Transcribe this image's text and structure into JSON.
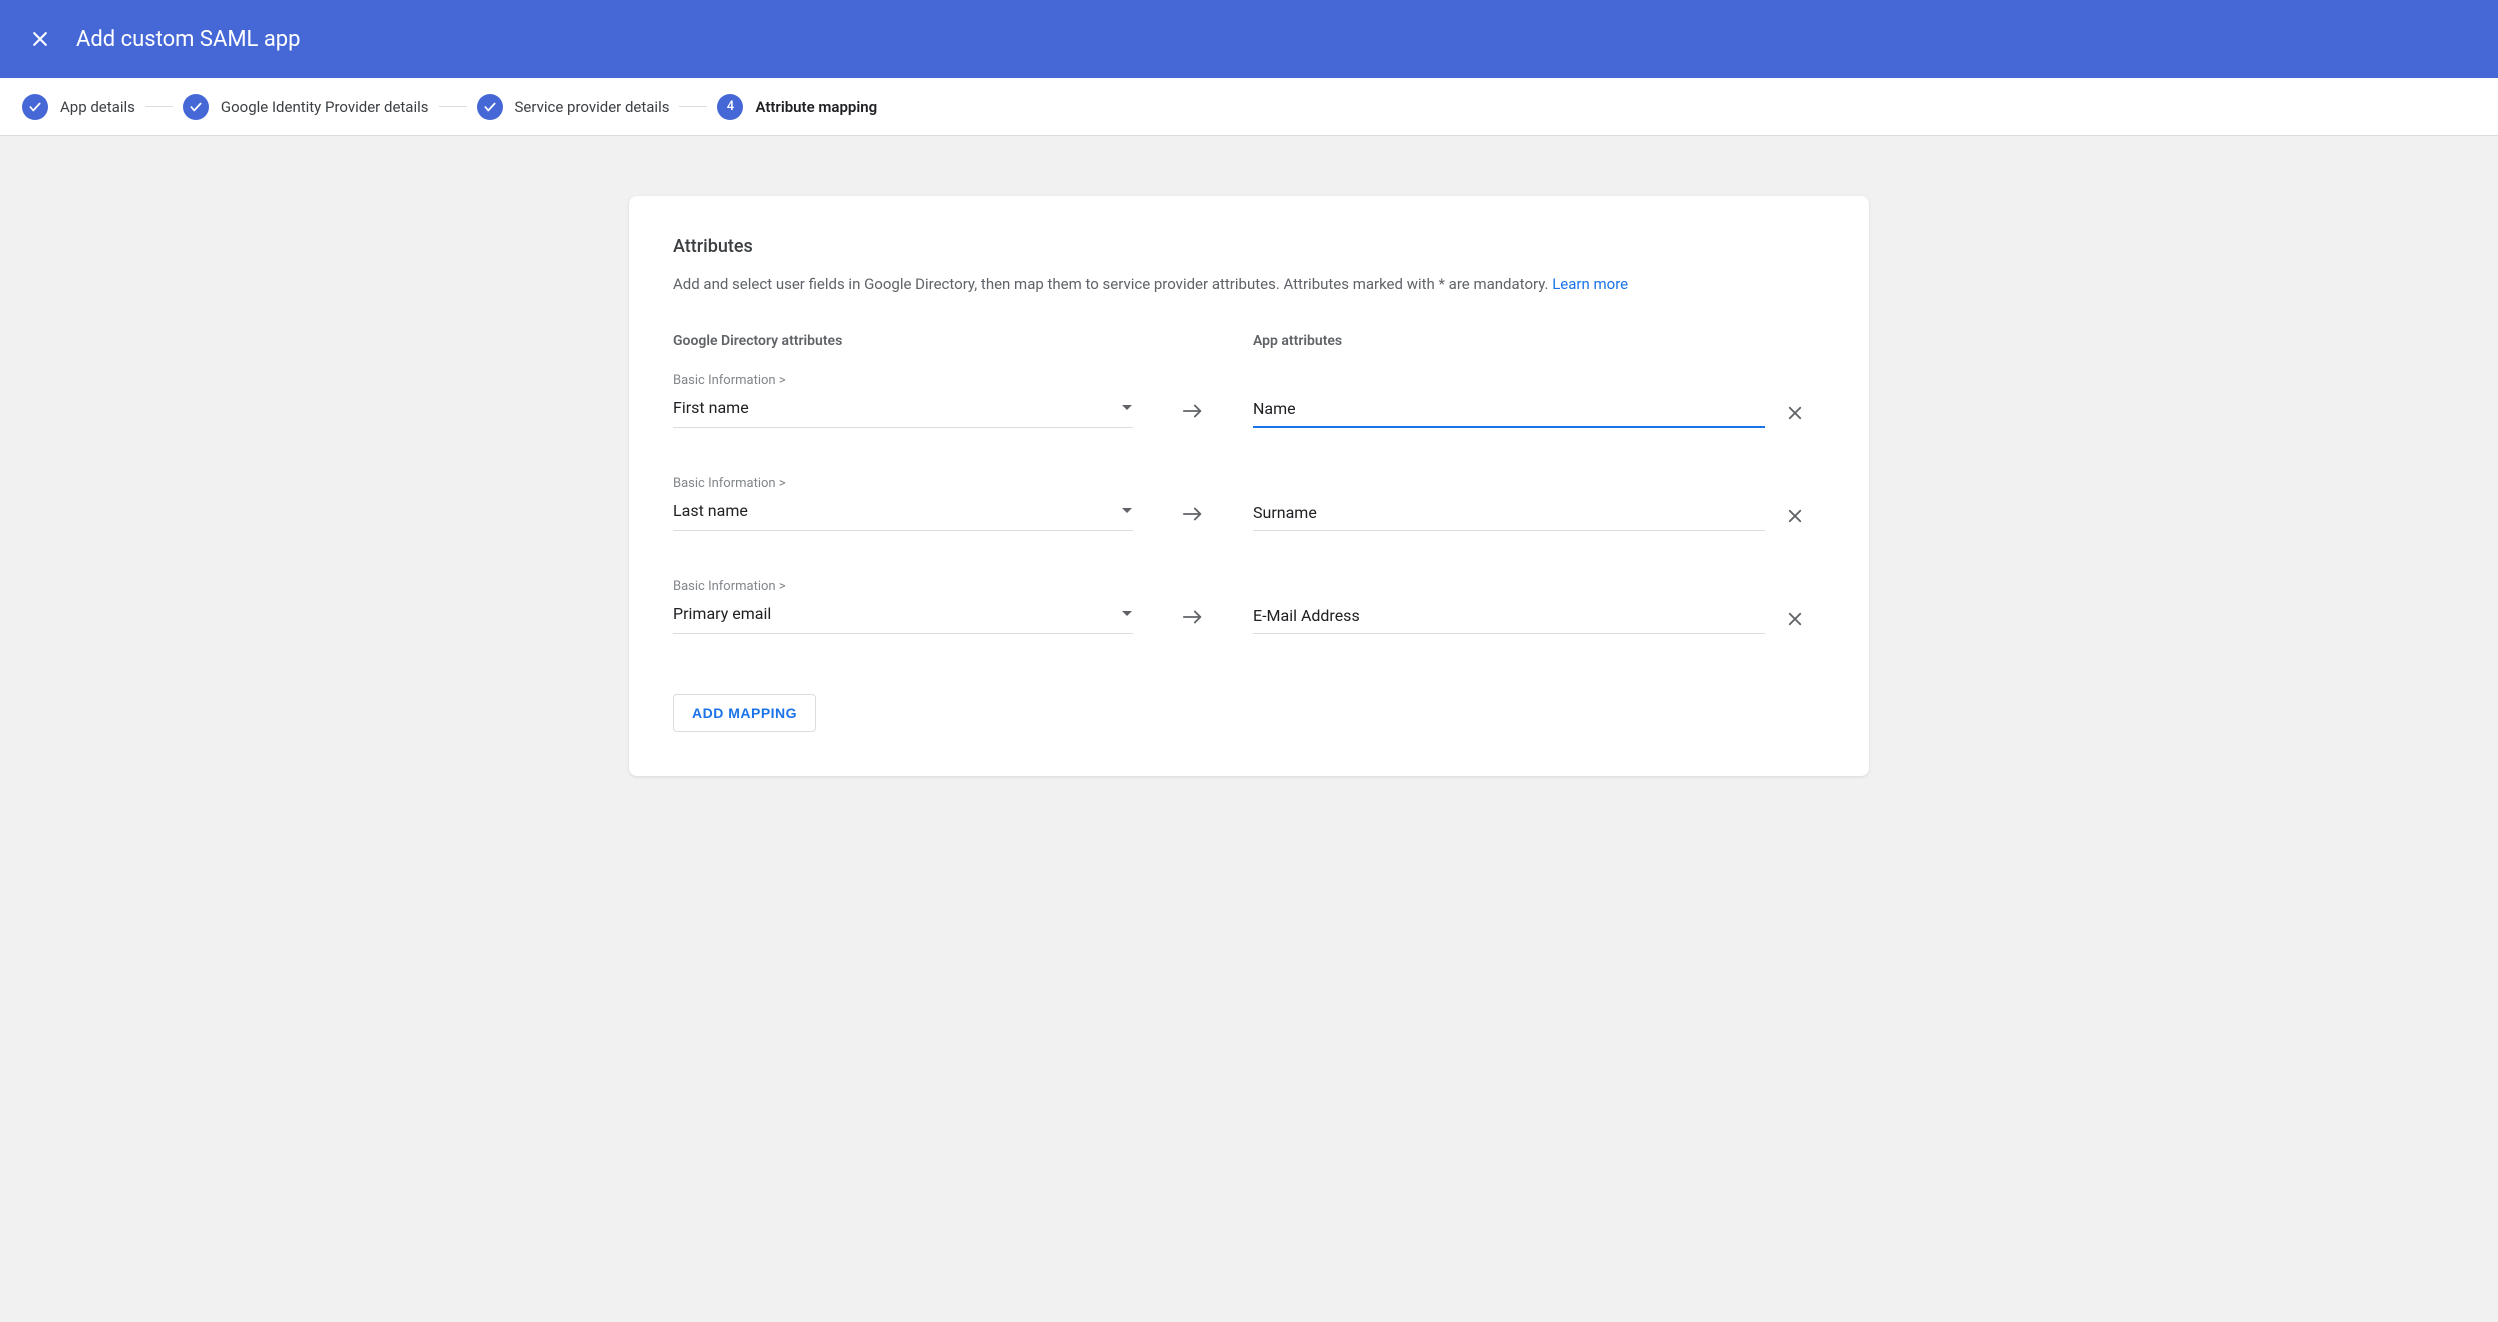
{
  "header": {
    "title": "Add custom SAML app"
  },
  "stepper": {
    "steps": [
      {
        "label": "App details",
        "state": "done"
      },
      {
        "label": "Google Identity Provider details",
        "state": "done"
      },
      {
        "label": "Service provider details",
        "state": "done"
      },
      {
        "label": "Attribute mapping",
        "state": "current",
        "number": "4"
      }
    ]
  },
  "card": {
    "title": "Attributes",
    "description": "Add and select user fields in Google Directory, then map them to service provider attributes. Attributes marked with * are mandatory. ",
    "learn_more": "Learn more",
    "col_left_header": "Google Directory attributes",
    "col_right_header": "App attributes",
    "rows": [
      {
        "category": "Basic Information >",
        "g_value": "First name",
        "app_value": "Name",
        "focused": true
      },
      {
        "category": "Basic Information >",
        "g_value": "Last name",
        "app_value": "Surname",
        "focused": false
      },
      {
        "category": "Basic Information >",
        "g_value": "Primary email",
        "app_value": "E-Mail Address",
        "focused": false
      }
    ],
    "add_mapping_label": "ADD MAPPING"
  }
}
